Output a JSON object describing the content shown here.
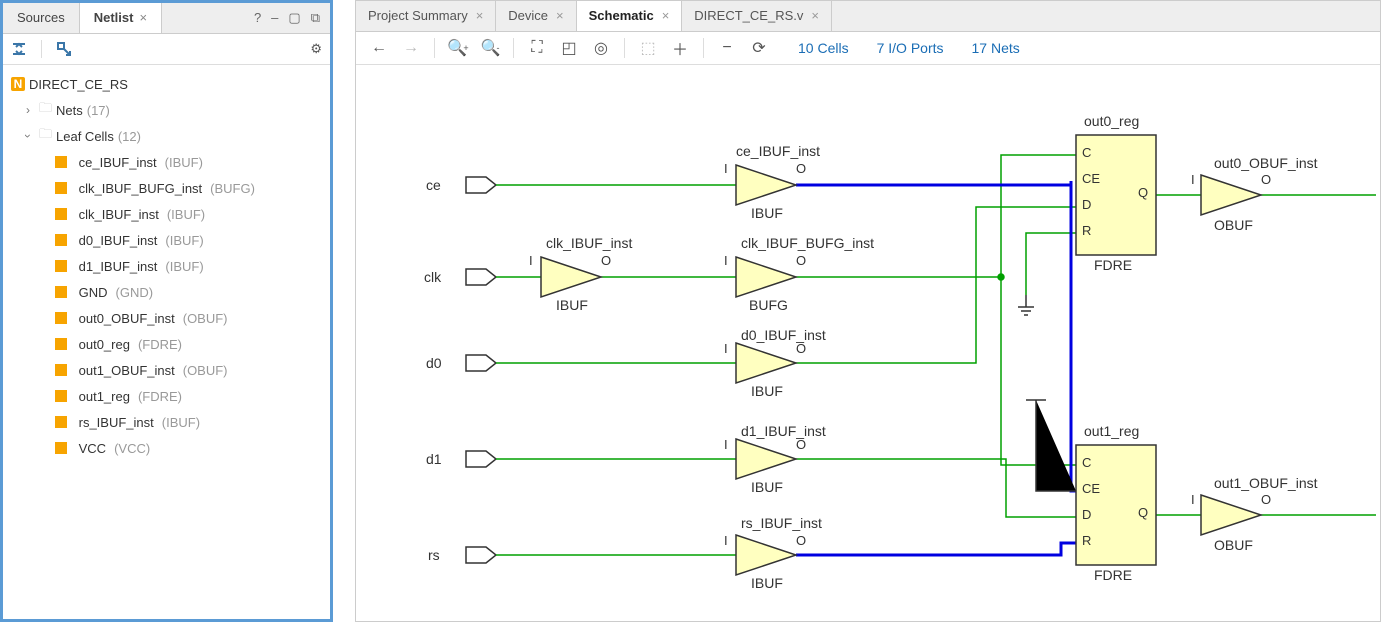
{
  "left": {
    "tabs": [
      {
        "label": "Sources",
        "active": false
      },
      {
        "label": "Netlist",
        "active": true
      }
    ],
    "root": "DIRECT_CE_RS",
    "nets": {
      "label": "Nets",
      "count": "(17)"
    },
    "leafcells": {
      "label": "Leaf Cells",
      "count": "(12)"
    },
    "cells": [
      {
        "name": "ce_IBUF_inst",
        "type": "(IBUF)"
      },
      {
        "name": "clk_IBUF_BUFG_inst",
        "type": "(BUFG)"
      },
      {
        "name": "clk_IBUF_inst",
        "type": "(IBUF)"
      },
      {
        "name": "d0_IBUF_inst",
        "type": "(IBUF)"
      },
      {
        "name": "d1_IBUF_inst",
        "type": "(IBUF)"
      },
      {
        "name": "GND",
        "type": "(GND)"
      },
      {
        "name": "out0_OBUF_inst",
        "type": "(OBUF)"
      },
      {
        "name": "out0_reg",
        "type": "(FDRE)"
      },
      {
        "name": "out1_OBUF_inst",
        "type": "(OBUF)"
      },
      {
        "name": "out1_reg",
        "type": "(FDRE)"
      },
      {
        "name": "rs_IBUF_inst",
        "type": "(IBUF)"
      },
      {
        "name": "VCC",
        "type": "(VCC)"
      }
    ]
  },
  "right": {
    "tabs": [
      {
        "label": "Project Summary",
        "active": false
      },
      {
        "label": "Device",
        "active": false
      },
      {
        "label": "Schematic",
        "active": true
      },
      {
        "label": "DIRECT_CE_RS.v",
        "active": false
      }
    ],
    "stats": {
      "cells": "10 Cells",
      "ports": "7 I/O Ports",
      "nets": "17 Nets"
    }
  },
  "schematic": {
    "ports": {
      "ce": "ce",
      "clk": "clk",
      "d0": "d0",
      "d1": "d1",
      "rs": "rs"
    },
    "ibuf": "IBUF",
    "bufg": "BUFG",
    "obuf": "OBUF",
    "fdre": "FDRE",
    "pinI": "I",
    "pinO": "O",
    "pinC": "C",
    "pinCE": "CE",
    "pinD": "D",
    "pinR": "R",
    "pinQ": "Q",
    "inst": {
      "ce_ibuf": "ce_IBUF_inst",
      "clk_ibuf": "clk_IBUF_inst",
      "clk_bufg": "clk_IBUF_BUFG_inst",
      "d0_ibuf": "d0_IBUF_inst",
      "d1_ibuf": "d1_IBUF_inst",
      "rs_ibuf": "rs_IBUF_inst",
      "out0_reg": "out0_reg",
      "out1_reg": "out1_reg",
      "out0_obuf": "out0_OBUF_inst",
      "out1_obuf": "out1_OBUF_inst"
    }
  }
}
